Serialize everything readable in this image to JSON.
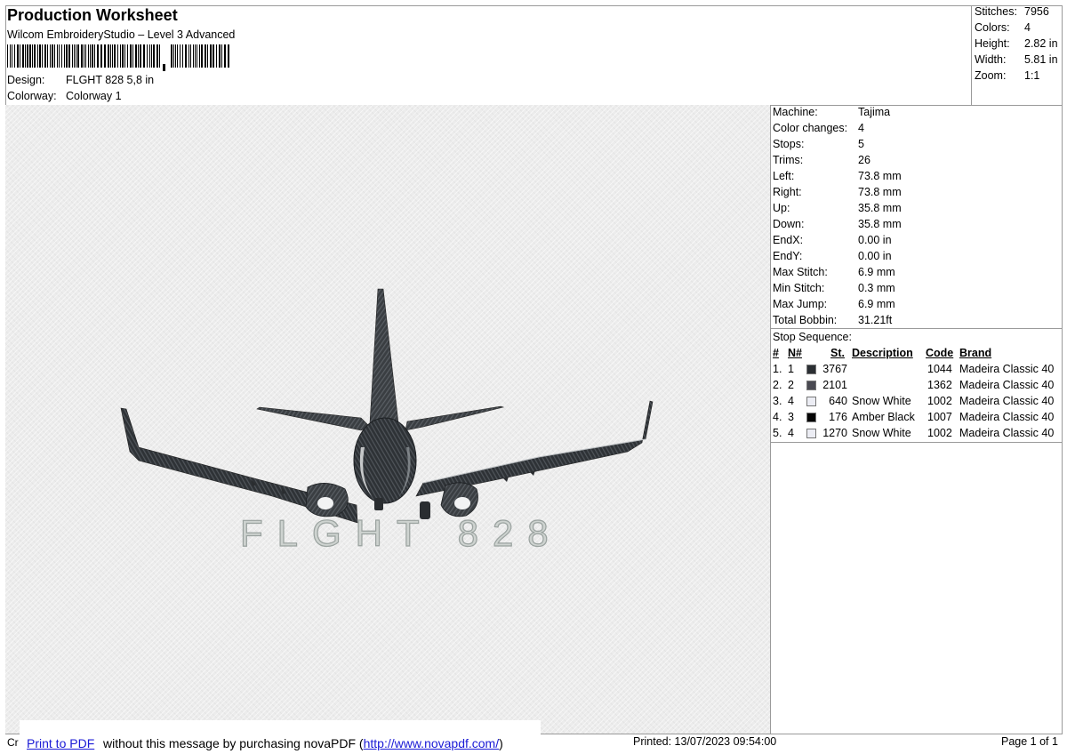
{
  "header": {
    "title": "Production Worksheet",
    "subtitle": "Wilcom EmbroideryStudio – Level 3 Advanced",
    "design_label": "Design:",
    "design_value": "FLGHT 828 5,8 in",
    "colorway_label": "Colorway:",
    "colorway_value": "Colorway 1"
  },
  "stats": [
    {
      "label": "Stitches:",
      "value": "7956"
    },
    {
      "label": "Colors:",
      "value": "4"
    },
    {
      "label": "Height:",
      "value": "2.82 in"
    },
    {
      "label": "Width:",
      "value": "5.81 in"
    },
    {
      "label": "Zoom:",
      "value": "1:1"
    }
  ],
  "design_text": "FLGHT 828",
  "machine_info": [
    {
      "label": "Machine:",
      "value": "Tajima"
    },
    {
      "label": "Color changes:",
      "value": "4"
    },
    {
      "label": "Stops:",
      "value": "5"
    },
    {
      "label": "Trims:",
      "value": "26"
    },
    {
      "label": "Left:",
      "value": "73.8 mm"
    },
    {
      "label": "Right:",
      "value": "73.8 mm"
    },
    {
      "label": "Up:",
      "value": "35.8 mm"
    },
    {
      "label": "Down:",
      "value": "35.8 mm"
    },
    {
      "label": "EndX:",
      "value": "0.00 in"
    },
    {
      "label": "EndY:",
      "value": "0.00 in"
    },
    {
      "label": "Max Stitch:",
      "value": "6.9 mm"
    },
    {
      "label": "Min Stitch:",
      "value": "0.3 mm"
    },
    {
      "label": "Max Jump:",
      "value": "6.9 mm"
    },
    {
      "label": "Total Bobbin:",
      "value": "31.21ft"
    }
  ],
  "stop_sequence": {
    "title": "Stop Sequence:",
    "headers": {
      "index": "#",
      "needle": "N#",
      "stitches": "St.",
      "description": "Description",
      "code": "Code",
      "brand": "Brand"
    },
    "rows": [
      {
        "index": "1.",
        "needle": "1",
        "color": "#2b2f33",
        "stitches": "3767",
        "description": "",
        "code": "1044",
        "brand": "Madeira Classic 40"
      },
      {
        "index": "2.",
        "needle": "2",
        "color": "#4a4a52",
        "stitches": "2101",
        "description": "",
        "code": "1362",
        "brand": "Madeira Classic 40"
      },
      {
        "index": "3.",
        "needle": "4",
        "color": "#ecedf4",
        "stitches": "640",
        "description": "Snow White",
        "code": "1002",
        "brand": "Madeira Classic 40"
      },
      {
        "index": "4.",
        "needle": "3",
        "color": "#050505",
        "stitches": "176",
        "description": "Amber Black",
        "code": "1007",
        "brand": "Madeira Classic 40"
      },
      {
        "index": "5.",
        "needle": "4",
        "color": "#ecedf4",
        "stitches": "1270",
        "description": "Snow White",
        "code": "1002",
        "brand": "Madeira Classic 40"
      }
    ]
  },
  "footer": {
    "cr": "Cr",
    "link_text": "Print to PDF",
    "message_before": " without this message by purchasing novaPDF (",
    "url": "http://www.novapdf.com/",
    "message_after": ")",
    "printed": "Printed: 13/07/2023 09:54:00",
    "page": "Page 1 of 1"
  }
}
